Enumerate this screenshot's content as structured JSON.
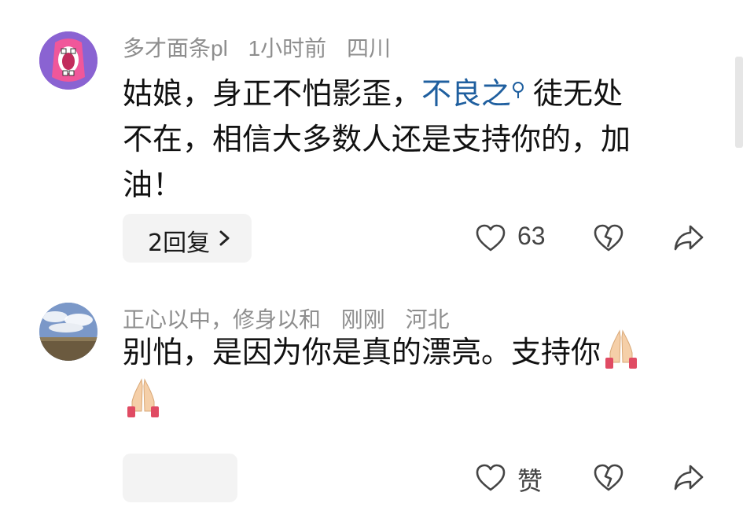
{
  "comments": [
    {
      "username": "多才面条pl",
      "time": "1小时前",
      "location": "四川",
      "text_line1_a": "姑娘，身正不怕影歪，",
      "text_link": "不良之",
      "text_line1_b": "徒无处",
      "text_line2": "不在，相信大多数人还是支持你的，加",
      "text_line3": "油！",
      "reply_label": "2回复",
      "like_count": "63"
    },
    {
      "username": "正心以中，修身以和",
      "time": "刚刚",
      "location": "河北",
      "text_line1": "别怕，是因为你是真的漂亮。支持你",
      "like_label": "赞"
    }
  ],
  "colors": {
    "link": "#1f5f9f",
    "meta": "#8e8e8e",
    "pill_bg": "#f3f3f3"
  },
  "icons": [
    "heart-icon",
    "broken-heart-icon",
    "share-icon",
    "chevron-right-icon",
    "search-icon",
    "folded-hands-emoji"
  ]
}
